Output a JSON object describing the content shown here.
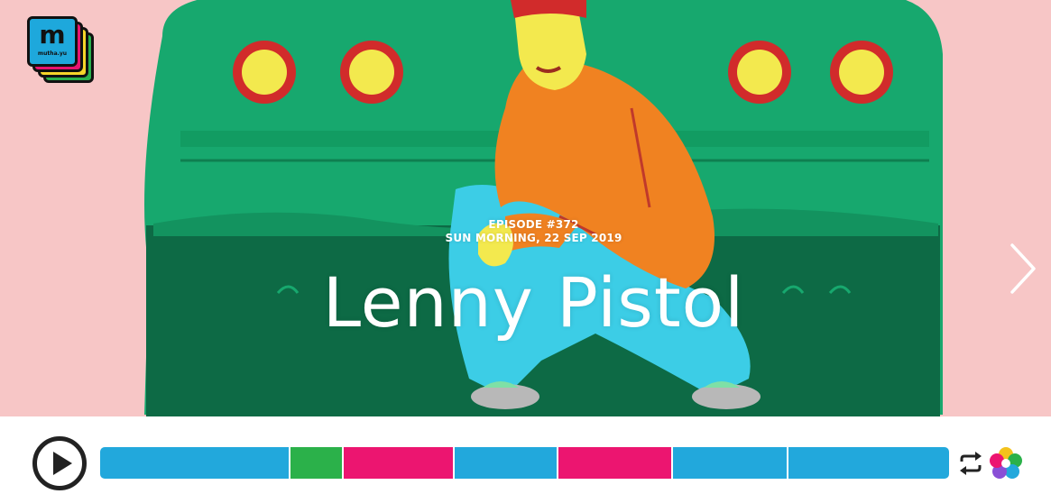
{
  "logo": {
    "letter": "m",
    "sub": "mutha.yu"
  },
  "episode": {
    "number_label": "EPISODE #372",
    "date_label": "SUN MORNING, 22 SEP 2019",
    "title": "Lenny Pistol"
  },
  "colors": {
    "hero_bg": "#f7c6c6",
    "car_green": "#17a86e",
    "car_dark": "#0d6a45",
    "tail_light_red": "#d12b2b",
    "tail_light_yellow": "#f3e94e",
    "sweater": "#f08221",
    "pants": "#3ccde6",
    "segment_blue": "#22a8dc",
    "segment_green": "#2bb14a",
    "segment_pink": "#ec1570"
  },
  "player": {
    "play_icon": "play-icon",
    "repeat_icon": "repeat-icon",
    "brand_icon": "flower-icon",
    "segments": [
      {
        "color": "#22a8dc",
        "share": 0.224
      },
      {
        "color": "#2bb14a",
        "share": 0.063
      },
      {
        "color": "#ec1570",
        "share": 0.131
      },
      {
        "color": "#22a8dc",
        "share": 0.122
      },
      {
        "color": "#ec1570",
        "share": 0.135
      },
      {
        "color": "#22a8dc",
        "share": 0.136
      },
      {
        "color": "#22a8dc",
        "share": 0.189
      }
    ]
  },
  "navigation": {
    "next_icon": "chevron-right-icon"
  }
}
